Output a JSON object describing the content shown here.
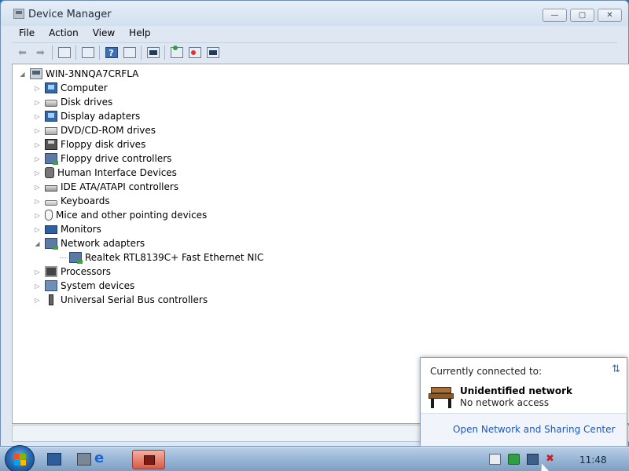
{
  "window": {
    "title": "Device Manager",
    "controls": {
      "minimize": "—",
      "maximize": "▢",
      "close": "✕"
    }
  },
  "menu": [
    "File",
    "Action",
    "View",
    "Help"
  ],
  "toolbar": {
    "buttons": [
      "back-icon",
      "forward-icon",
      "show-hide-tree-icon",
      "properties-icon",
      "help-icon",
      "show-hide-action-pane-icon",
      "scan-hardware-icon",
      "update-driver-icon",
      "uninstall-icon",
      "disable-icon"
    ]
  },
  "tree": {
    "root": "WIN-3NNQA7CRFLA",
    "categories": [
      {
        "label": "Computer",
        "icon": "computer-icon",
        "expanded": false
      },
      {
        "label": "Disk drives",
        "icon": "disk-drive-icon",
        "expanded": false
      },
      {
        "label": "Display adapters",
        "icon": "display-adapter-icon",
        "expanded": false
      },
      {
        "label": "DVD/CD-ROM drives",
        "icon": "dvd-drive-icon",
        "expanded": false
      },
      {
        "label": "Floppy disk drives",
        "icon": "floppy-disk-icon",
        "expanded": false
      },
      {
        "label": "Floppy drive controllers",
        "icon": "floppy-controller-icon",
        "expanded": false
      },
      {
        "label": "Human Interface Devices",
        "icon": "hid-icon",
        "expanded": false
      },
      {
        "label": "IDE ATA/ATAPI controllers",
        "icon": "ide-controller-icon",
        "expanded": false
      },
      {
        "label": "Keyboards",
        "icon": "keyboard-icon",
        "expanded": false
      },
      {
        "label": "Mice and other pointing devices",
        "icon": "mouse-icon",
        "expanded": false
      },
      {
        "label": "Monitors",
        "icon": "monitor-icon",
        "expanded": false
      },
      {
        "label": "Network adapters",
        "icon": "network-adapter-icon",
        "expanded": true,
        "children": [
          "Realtek RTL8139C+ Fast Ethernet NIC"
        ]
      },
      {
        "label": "Processors",
        "icon": "processor-icon",
        "expanded": false
      },
      {
        "label": "System devices",
        "icon": "system-devices-icon",
        "expanded": false
      },
      {
        "label": "Universal Serial Bus controllers",
        "icon": "usb-icon",
        "expanded": false
      }
    ]
  },
  "network_popup": {
    "title": "Currently connected to:",
    "network_name": "Unidentified network",
    "network_status": "No network access",
    "link": "Open Network and Sharing Center"
  },
  "taskbar": {
    "clock": "11:48"
  }
}
